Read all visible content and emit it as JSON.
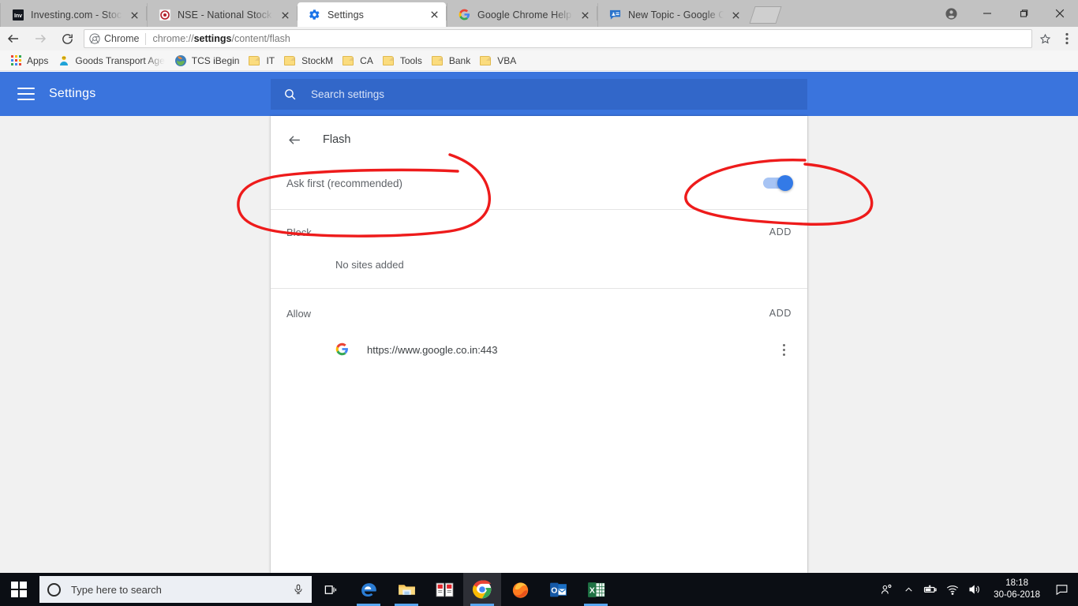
{
  "browser": {
    "tabs": [
      {
        "title": "Investing.com - Stock Ma",
        "favicon": "investing-favicon",
        "active": false
      },
      {
        "title": "NSE - National Stock Exch",
        "favicon": "nse-favicon",
        "active": false
      },
      {
        "title": "Settings",
        "favicon": "gear-icon",
        "active": true
      },
      {
        "title": "Google Chrome Help",
        "favicon": "google-favicon",
        "active": false
      },
      {
        "title": "New Topic - Google Chro",
        "favicon": "forum-favicon",
        "active": false
      }
    ],
    "new_tab_label": "New tab",
    "window_controls": {
      "minimize": "Minimize",
      "maximize": "Maximize",
      "close": "Close",
      "profile": "Profile"
    },
    "nav": {
      "back": "Back",
      "forward": "Forward",
      "reload": "Reload"
    },
    "omnibox": {
      "chip_label": "Chrome",
      "url_prefix": "chrome://",
      "url_bold": "settings",
      "url_suffix": "/content/flash",
      "full_url": "chrome://settings/content/flash",
      "bookmark_star": "bookmark-star-icon",
      "menu": "chrome-menu-icon"
    },
    "bookmarks": [
      {
        "label": "Apps",
        "icon": "apps-grid-icon"
      },
      {
        "label": "Goods Transport Age",
        "icon": "site-favicon"
      },
      {
        "label": "TCS iBegin",
        "icon": "site-favicon"
      },
      {
        "label": "IT",
        "icon": "folder-icon"
      },
      {
        "label": "StockM",
        "icon": "folder-icon"
      },
      {
        "label": "CA",
        "icon": "folder-icon"
      },
      {
        "label": "Tools",
        "icon": "folder-icon"
      },
      {
        "label": "Bank",
        "icon": "folder-icon"
      },
      {
        "label": "VBA",
        "icon": "folder-icon"
      }
    ]
  },
  "settings": {
    "header": {
      "title": "Settings",
      "menu_icon": "hamburger-icon",
      "search_icon": "search-icon",
      "search_placeholder": "Search settings",
      "search_value": ""
    },
    "page": {
      "back_icon": "back-arrow-icon",
      "title": "Flash",
      "toggle_row": {
        "label": "Ask first (recommended)",
        "toggle_state": "on"
      },
      "block_section": {
        "title": "Block",
        "add_label": "ADD",
        "empty_text": "No sites added",
        "sites": []
      },
      "allow_section": {
        "title": "Allow",
        "add_label": "ADD",
        "sites": [
          {
            "url": "https://www.google.co.in:443",
            "favicon": "google-favicon",
            "menu_icon": "kebab-menu-icon"
          }
        ]
      }
    }
  },
  "annotations": {
    "ink_color": "#ee1b1b",
    "marks": [
      {
        "name": "circle-around-ask-first",
        "target": "Ask first (recommended)"
      },
      {
        "name": "circle-around-flash-toggle",
        "target": "flash toggle"
      }
    ]
  },
  "taskbar": {
    "start_label": "Start",
    "search_placeholder": "Type here to search",
    "cortana_mic_icon": "microphone-icon",
    "task_view_icon": "task-view-icon",
    "apps": [
      {
        "name": "microsoft-edge",
        "running": true
      },
      {
        "name": "file-explorer",
        "running": true
      },
      {
        "name": "dictionary-app",
        "running": false
      },
      {
        "name": "google-chrome",
        "running": true,
        "active": true
      },
      {
        "name": "mozilla-firefox",
        "running": false
      },
      {
        "name": "microsoft-outlook",
        "running": false
      },
      {
        "name": "microsoft-excel",
        "running": true
      }
    ],
    "tray": {
      "people_icon": "people-icon",
      "show_hidden_icon": "chevron-up-icon",
      "battery_icon": "battery-charging-icon",
      "network_icon": "wifi-icon",
      "volume_icon": "speaker-icon",
      "time": "18:18",
      "date": "30-06-2018",
      "action_center_icon": "action-center-icon"
    }
  },
  "colors": {
    "settings_header_blue": "#3a74dd",
    "search_box_blue": "#3267c9",
    "toggle_on_blue": "#337ae7",
    "ink_red": "#ee1b1b",
    "page_bg": "#f1f1f1",
    "taskbar_bg": "#0b0e14"
  }
}
